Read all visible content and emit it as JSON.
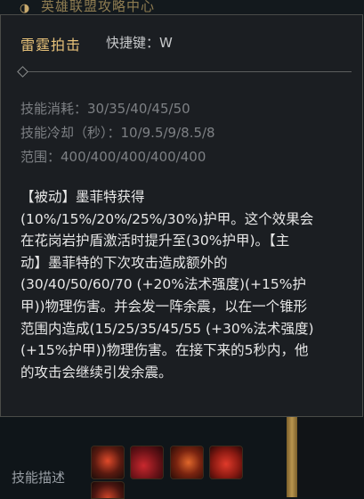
{
  "background": {
    "header_title": "英雄联盟攻略中心",
    "section_label": "技能描述",
    "skill_icons": [
      "skill-icon-1",
      "skill-icon-2",
      "skill-icon-3",
      "skill-icon-4",
      "skill-icon-5"
    ]
  },
  "tooltip": {
    "skill_name": "雷霆拍击",
    "hotkey": "快捷键：W",
    "stats": {
      "cost": "技能消耗：30/35/40/45/50",
      "cooldown": "技能冷却（秒）：10/9.5/9/8.5/8",
      "range": "范围：400/400/400/400/400"
    },
    "description_lines": [
      "【被动】墨菲特获得",
      "(10%/15%/20%/25%/30%)护甲。这个效果会",
      "在花岗岩护盾激活时提升至(30%护甲)。【主",
      "动】墨菲特的下次攻击造成额外的",
      "(30/40/50/60/70 (+20%法术强度)(+15%护",
      "甲))物理伤害。并会发一阵余震，以在一个锥形",
      "范围内造成(15/25/35/45/55 (+30%法术强度)",
      "(+15%护甲))物理伤害。在接下来的5秒内，他",
      "的攻击会继续引发余震。"
    ]
  },
  "colors": {
    "skill_name": "#e6c179",
    "tooltip_bg": "#1b1e22",
    "stat_text": "#7d8084",
    "body_text": "#e7e7e7"
  }
}
